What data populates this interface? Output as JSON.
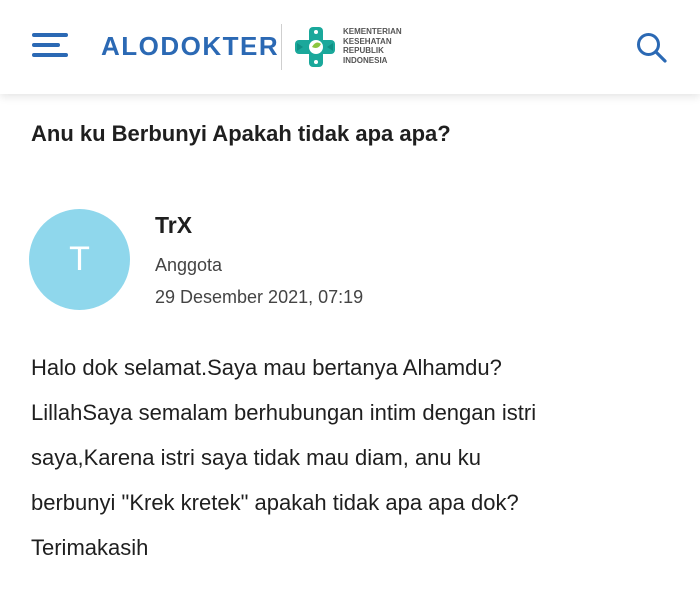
{
  "header": {
    "brand": "ALODOKTER",
    "partner_logo_text": "KEMENTERIAN\nKESEHATAN\nREPUBLIK\nINDONESIA",
    "brand_color": "#2b69b4",
    "icons": {
      "menu": "hamburger-menu-icon",
      "search": "search-icon",
      "partner": "kemenkes-logo-icon"
    }
  },
  "question": {
    "title": "Anu ku Berbunyi Apakah tidak apa apa?",
    "author": {
      "avatar_letter": "T",
      "avatar_color": "#8fd7ec",
      "name": "TrX",
      "role": "Anggota",
      "date": "29 Desember 2021, 07:19"
    },
    "body_lines": [
      "Halo dok selamat.Saya mau bertanya Alhamdu?",
      "LillahSaya semalam berhubungan intim dengan istri",
      "saya,Karena istri saya tidak mau diam, anu ku",
      "berbunyi \"Krek kretek\" apakah tidak apa apa dok?",
      "Terimakasih"
    ]
  }
}
